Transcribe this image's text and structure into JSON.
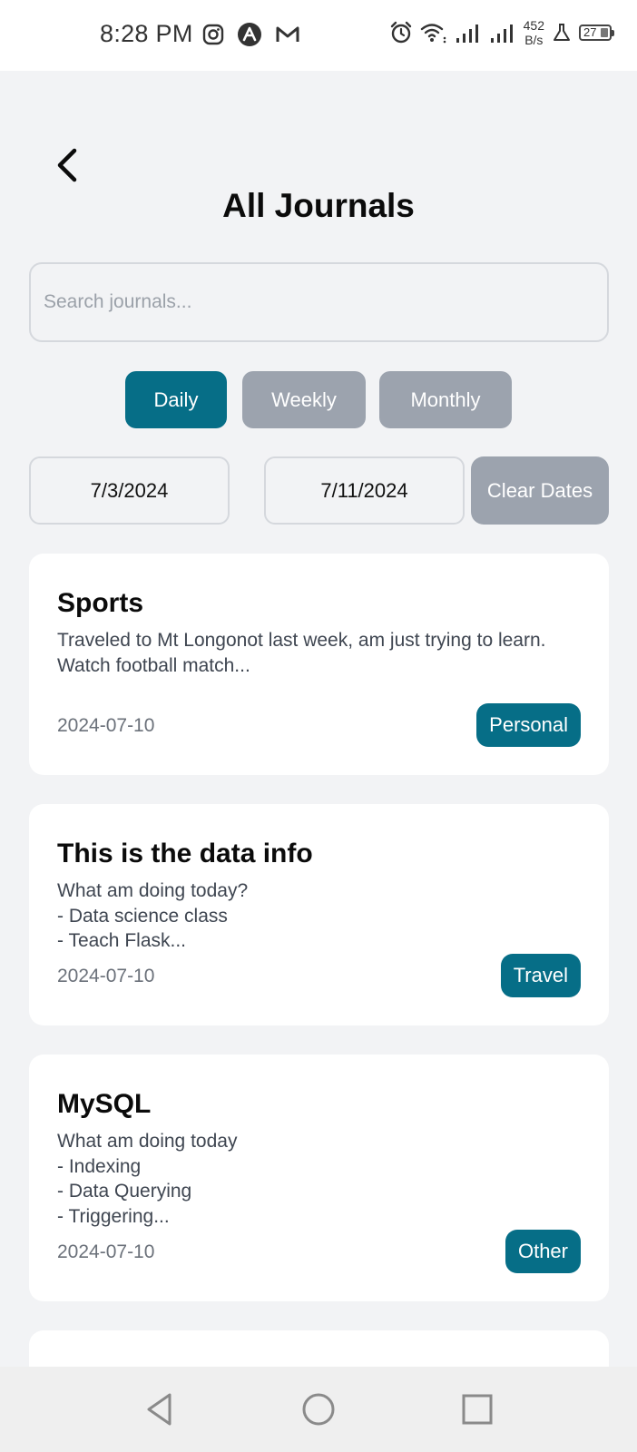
{
  "status_bar": {
    "time": "8:28 PM",
    "net_speed_value": "452",
    "net_speed_unit": "B/s",
    "battery": "27"
  },
  "header": {
    "title": "All Journals"
  },
  "search": {
    "placeholder": "Search journals...",
    "value": ""
  },
  "filters": {
    "tabs": [
      {
        "label": "Daily",
        "active": true
      },
      {
        "label": "Weekly",
        "active": false
      },
      {
        "label": "Monthly",
        "active": false
      }
    ]
  },
  "dates": {
    "start": "7/3/2024",
    "end": "7/11/2024",
    "clear_label": "Clear Dates"
  },
  "journals": [
    {
      "title": "Sports",
      "body": "Traveled to Mt Longonot last week, am just trying to learn.\nWatch football match...",
      "date": "2024-07-10",
      "category": "Personal"
    },
    {
      "title": "This is the data info",
      "body": "What am doing today?\n- Data science class\n-  Teach Flask...",
      "date": "2024-07-10",
      "category": "Travel"
    },
    {
      "title": "MySQL",
      "body": "What am doing today\n- Indexing\n- Data Querying\n- Triggering...",
      "date": "2024-07-10",
      "category": "Other"
    }
  ],
  "colors": {
    "accent": "#066e87",
    "inactive": "#9ca3ae",
    "background": "#f2f3f5"
  }
}
